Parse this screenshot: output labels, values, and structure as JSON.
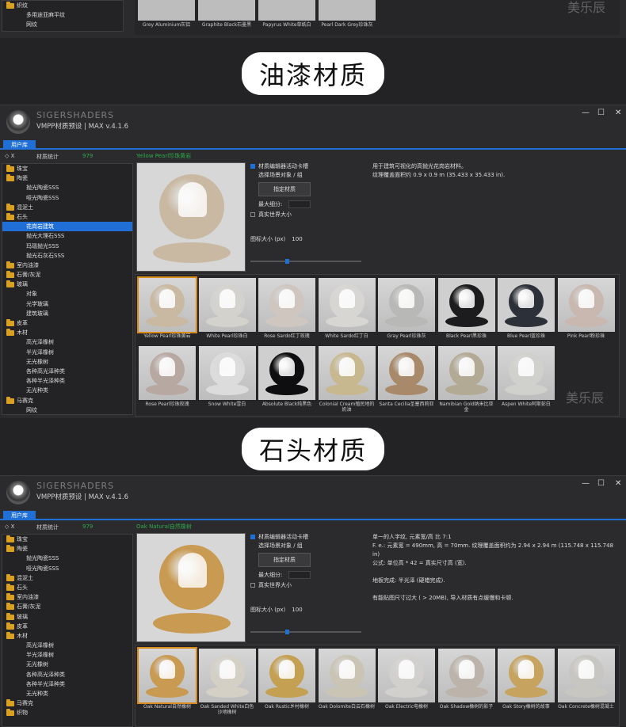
{
  "top": {
    "sidebar_items": [
      {
        "label": "织纹",
        "type": "folder"
      },
      {
        "label": "多用途亚麻平纹",
        "type": "sub"
      },
      {
        "label": "网纹",
        "type": "sub"
      }
    ],
    "thumbs": [
      "Grey Aluminium灰铝",
      "Graphite Black石墨黑",
      "Papyrus White草纸白",
      "Pearl Dark Grey珍珠灰"
    ],
    "watermark": "美乐辰"
  },
  "banner1": "油漆材质",
  "banner2": "石头材质",
  "win1": {
    "brand": "SIGERSHADERS",
    "version": "VMPP材质预设 | MAX v.4.1.6",
    "tab": "用户库",
    "side_hdr_label": "材质统计",
    "side_hdr_count": "979",
    "side_hdr_icons": "◇ X",
    "sidebar": [
      {
        "label": "珠宝",
        "level": 0
      },
      {
        "label": "陶瓷",
        "level": 0
      },
      {
        "label": "抛光陶瓷SSS",
        "level": 1
      },
      {
        "label": "哑光陶瓷SSS",
        "level": 1
      },
      {
        "label": "混泥土",
        "level": 0
      },
      {
        "label": "石头",
        "level": 0
      },
      {
        "label": "花岗岩建筑",
        "level": 1,
        "selected": true
      },
      {
        "label": "抛光大理石SSS",
        "level": 1
      },
      {
        "label": "玛瑙抛光SSS",
        "level": 1
      },
      {
        "label": "抛光石灰石SSS",
        "level": 1
      },
      {
        "label": "室内油漆",
        "level": 0
      },
      {
        "label": "石膏/灰泥",
        "level": 0
      },
      {
        "label": "玻璃",
        "level": 0
      },
      {
        "label": "对象",
        "level": 1
      },
      {
        "label": "光学玻璃",
        "level": 1
      },
      {
        "label": "建筑玻璃",
        "level": 1
      },
      {
        "label": "皮革",
        "level": 0
      },
      {
        "label": "木材",
        "level": 0
      },
      {
        "label": "高光泽橡树",
        "level": 1
      },
      {
        "label": "半光泽橡树",
        "level": 1
      },
      {
        "label": "无光橡树",
        "level": 1
      },
      {
        "label": "各种高光泽种类",
        "level": 1
      },
      {
        "label": "各种半光泽种类",
        "level": 1
      },
      {
        "label": "无光种类",
        "level": 1
      },
      {
        "label": "马赛克",
        "level": 0
      },
      {
        "label": "网纹",
        "level": 1
      }
    ],
    "material_title": "Yellow Pearl珍珠黄岩",
    "opt_editor": "材质编辑器活动卡槽",
    "opt_select": "选择场景对象 / 组",
    "btn_assign": "指定材质",
    "opt_maxsub": "最大细分:",
    "opt_real": "真实世界大小",
    "icon_size_label": "图标大小 (px)",
    "icon_size": "100",
    "desc_lines": [
      "用于建筑可视化的高抛光花岗岩材料。",
      "纹理覆盖面积约 0.9 x 0.9 m (35.433 x 35.433 in)."
    ],
    "thumbs": [
      {
        "label": "Yellow Pearl珍珠黄岩",
        "color": "#c9b9a3",
        "selected": true
      },
      {
        "label": "White Pearl珍珠白",
        "color": "#d4d2cc"
      },
      {
        "label": "Rose Sardo红丁玫瑰",
        "color": "#cfc6c0"
      },
      {
        "label": "White Sardo红丁白",
        "color": "#d8d6d2"
      },
      {
        "label": "Gray Pearl珍珠灰",
        "color": "#b8b8b6"
      },
      {
        "label": "Black Pearl黑珍珠",
        "color": "#1c1c1e"
      },
      {
        "label": "Blue Pearl蓝珍珠",
        "color": "#2c3038"
      },
      {
        "label": "Pink Pearl粉珍珠",
        "color": "#c8b8b0"
      },
      {
        "label": "Rose Pearl珍珠玫瑰",
        "color": "#b8a8a2"
      },
      {
        "label": "Snow White雪白",
        "color": "#dcdcdc"
      },
      {
        "label": "Absolute Black纯黑色",
        "color": "#0e0e10"
      },
      {
        "label": "Colonial Cream殖民地的奶油",
        "color": "#c8b890"
      },
      {
        "label": "Santa Cecilia圣塞西莉亚",
        "color": "#a88a6a"
      },
      {
        "label": "Namibian Gold纳米比亚金",
        "color": "#b2aa94"
      },
      {
        "label": "Aspen White阿斯彭白",
        "color": "#d0d0cc"
      }
    ],
    "watermark": "美乐辰"
  },
  "win2": {
    "brand": "SIGERSHADERS",
    "version": "VMPP材质预设 | MAX v.4.1.6",
    "tab": "用户库",
    "side_hdr_label": "材质统计",
    "side_hdr_count": "979",
    "side_hdr_icons": "◇ X",
    "sidebar": [
      {
        "label": "珠宝",
        "level": 0
      },
      {
        "label": "陶瓷",
        "level": 0
      },
      {
        "label": "抛光陶瓷SSS",
        "level": 1
      },
      {
        "label": "哑光陶瓷SSS",
        "level": 1
      },
      {
        "label": "混泥土",
        "level": 0
      },
      {
        "label": "石头",
        "level": 0
      },
      {
        "label": "室内油漆",
        "level": 0
      },
      {
        "label": "石膏/灰泥",
        "level": 0
      },
      {
        "label": "玻璃",
        "level": 0
      },
      {
        "label": "皮革",
        "level": 0
      },
      {
        "label": "木材",
        "level": 0
      },
      {
        "label": "高光泽橡树",
        "level": 1
      },
      {
        "label": "半光泽橡树",
        "level": 1
      },
      {
        "label": "无光橡树",
        "level": 1
      },
      {
        "label": "各种高光泽种类",
        "level": 1
      },
      {
        "label": "各种半光泽种类",
        "level": 1
      },
      {
        "label": "无光种类",
        "level": 1
      },
      {
        "label": "马赛克",
        "level": 0
      },
      {
        "label": "织物",
        "level": 0
      }
    ],
    "material_title": "Oak Natural自然橡树",
    "opt_editor": "材质编辑器活动卡槽",
    "opt_select": "选择场景对象 / 组",
    "btn_assign": "指定材质",
    "opt_maxsub": "最大细分:",
    "opt_real": "真实世界大小",
    "icon_size_label": "图标大小 (px)",
    "icon_size": "100",
    "desc_lines": [
      "单一的人字纹, 元素宽/高 比 7:1",
      "F. e.: 元素宽 = 490mm, 高 = 70mm. 纹理覆盖面积约为 2.94 x 2.94 m (115.748 x 115.748 in)",
      "公式: 单位高 * 42 = 真实尺寸高 (宽).",
      "",
      "地板完成: 半光泽 (硬蜡完成).",
      "",
      "有能贴图尺寸过大 ( > 20MB), 导入材质有点缓慢和卡顿."
    ],
    "thumbs": [
      {
        "label": "Oak Natural自然橡树",
        "color": "#c89a52",
        "selected": true
      },
      {
        "label": "Oak Sanded White白色沙地橡树",
        "color": "#d4d0c6"
      },
      {
        "label": "Oak Rustic乡村橡树",
        "color": "#c4a052"
      },
      {
        "label": "Oak Dolomite白云石橡树",
        "color": "#cac4b4"
      },
      {
        "label": "Oak Electric电橡树",
        "color": "#d2d0cc"
      },
      {
        "label": "Oak Shadow橡树的影子",
        "color": "#bcb4aa"
      },
      {
        "label": "Oak Story橡树的故事",
        "color": "#c6a460"
      },
      {
        "label": "Oak Concrete橡树混凝土",
        "color": "#c8c6c0"
      }
    ]
  }
}
